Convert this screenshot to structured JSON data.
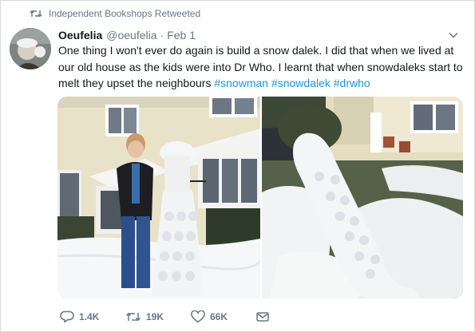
{
  "retweet_banner": {
    "text": "Independent Bookshops Retweeted"
  },
  "tweet": {
    "author_name": "Oeufelia",
    "author_handle": "@oeufelia",
    "separator": "·",
    "time": "Feb 1",
    "text_part1": "One thing I won't ever do again is build a snow dalek. I did that when we lived at our old house as the kids were into Dr Who. I learnt that when snowdaleks start to melt they upset the neighbours ",
    "hashtags": [
      "#snowman",
      "#snowdalek",
      "#drwho"
    ]
  },
  "actions": {
    "replies": "1.4K",
    "retweets": "19K",
    "likes": "66K"
  },
  "colors": {
    "link": "#1b95e0",
    "muted": "#657786",
    "text": "#14171a"
  },
  "icons": {
    "retweet_banner": "retweet-icon",
    "menu": "chevron-down-icon",
    "reply": "reply-icon",
    "retweet": "retweet-icon",
    "like": "heart-icon",
    "dm": "envelope-icon"
  }
}
